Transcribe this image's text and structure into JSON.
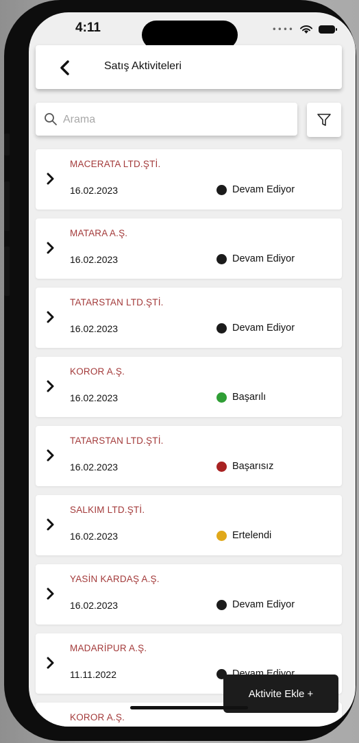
{
  "status_bar": {
    "time": "4:11"
  },
  "header": {
    "title": "Satış Aktiviteleri"
  },
  "search": {
    "placeholder": "Arama"
  },
  "colors": {
    "company_text": "#a33a3a",
    "devam": "#1b1b1b",
    "basarili": "#2f9e35",
    "basarisiz": "#a82222",
    "ertelendi": "#e0a81a"
  },
  "activities": [
    {
      "company": "MACERATA LTD.ŞTİ.",
      "date": "16.02.2023",
      "status": "Devam Ediyor",
      "status_color": "#1b1b1b"
    },
    {
      "company": "MATARA A.Ş.",
      "date": "16.02.2023",
      "status": "Devam Ediyor",
      "status_color": "#1b1b1b"
    },
    {
      "company": "TATARSTAN LTD.ŞTİ.",
      "date": "16.02.2023",
      "status": "Devam Ediyor",
      "status_color": "#1b1b1b"
    },
    {
      "company": "KOROR A.Ş.",
      "date": "16.02.2023",
      "status": "Başarılı",
      "status_color": "#2f9e35"
    },
    {
      "company": "TATARSTAN LTD.ŞTİ.",
      "date": "16.02.2023",
      "status": "Başarısız",
      "status_color": "#a82222"
    },
    {
      "company": "SALKIM LTD.ŞTİ.",
      "date": "16.02.2023",
      "status": "Ertelendi",
      "status_color": "#e0a81a"
    },
    {
      "company": "YASİN KARDAŞ A.Ş.",
      "date": "16.02.2023",
      "status": "Devam Ediyor",
      "status_color": "#1b1b1b"
    },
    {
      "company": "MADARİPUR A.Ş.",
      "date": "11.11.2022",
      "status": "Devam Ediyor",
      "status_color": "#1b1b1b"
    },
    {
      "company": "KOROR A.Ş.",
      "date": "",
      "status": "",
      "status_color": "#1b1b1b"
    }
  ],
  "fab": {
    "label": "Aktivite Ekle +"
  }
}
